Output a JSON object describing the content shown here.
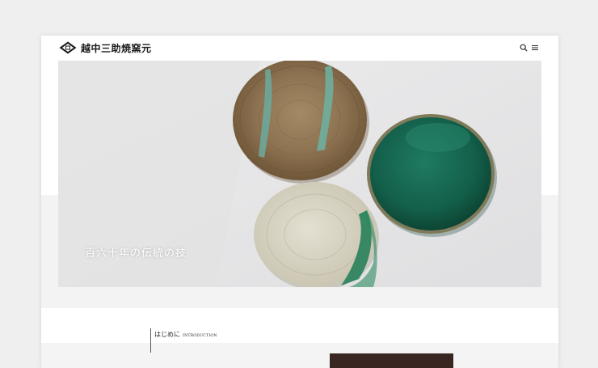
{
  "header": {
    "logo_text": "越中三助焼窯元",
    "icons": {
      "search": "search-icon",
      "menu": "menu-icon"
    }
  },
  "hero": {
    "caption": "百六十年の伝統の技",
    "image": "three-ceramic-plates"
  },
  "intro": {
    "title_jp": "はじめに",
    "title_en": "INTRODUCTION"
  },
  "colors": {
    "page_bg": "#efefef",
    "accent_dark": "#3a2620",
    "text": "#1a1a1a"
  }
}
